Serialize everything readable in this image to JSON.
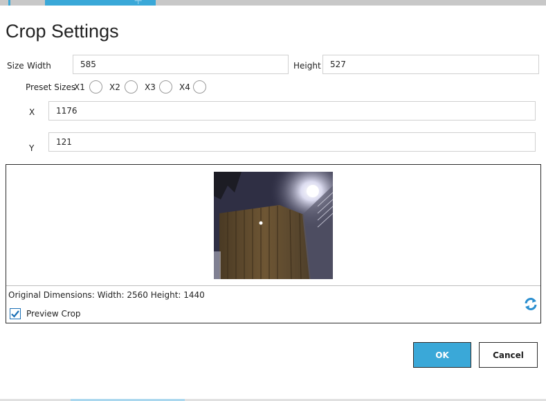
{
  "dialog": {
    "title": "Crop Settings"
  },
  "size": {
    "section_label": "Size",
    "width_label": "Width",
    "width_value": "585",
    "height_label": "Height",
    "height_value": "527"
  },
  "presets": {
    "label": "Preset Sizes",
    "options": [
      "X1",
      "X2",
      "X3",
      "X4"
    ]
  },
  "position": {
    "x_label": "X",
    "x_value": "1176",
    "y_label": "Y",
    "y_value": "121"
  },
  "preview": {
    "original_dimensions": "Original Dimensions: Width: 2560 Height: 1440",
    "preview_crop_label": "Preview Crop",
    "preview_crop_checked": true
  },
  "buttons": {
    "ok": "OK",
    "cancel": "Cancel"
  },
  "colors": {
    "accent": "#3aa8d8",
    "checkbox": "#1a6fb5"
  },
  "icons": {
    "refresh": "refresh-icon",
    "checkmark": "checkmark-icon"
  }
}
